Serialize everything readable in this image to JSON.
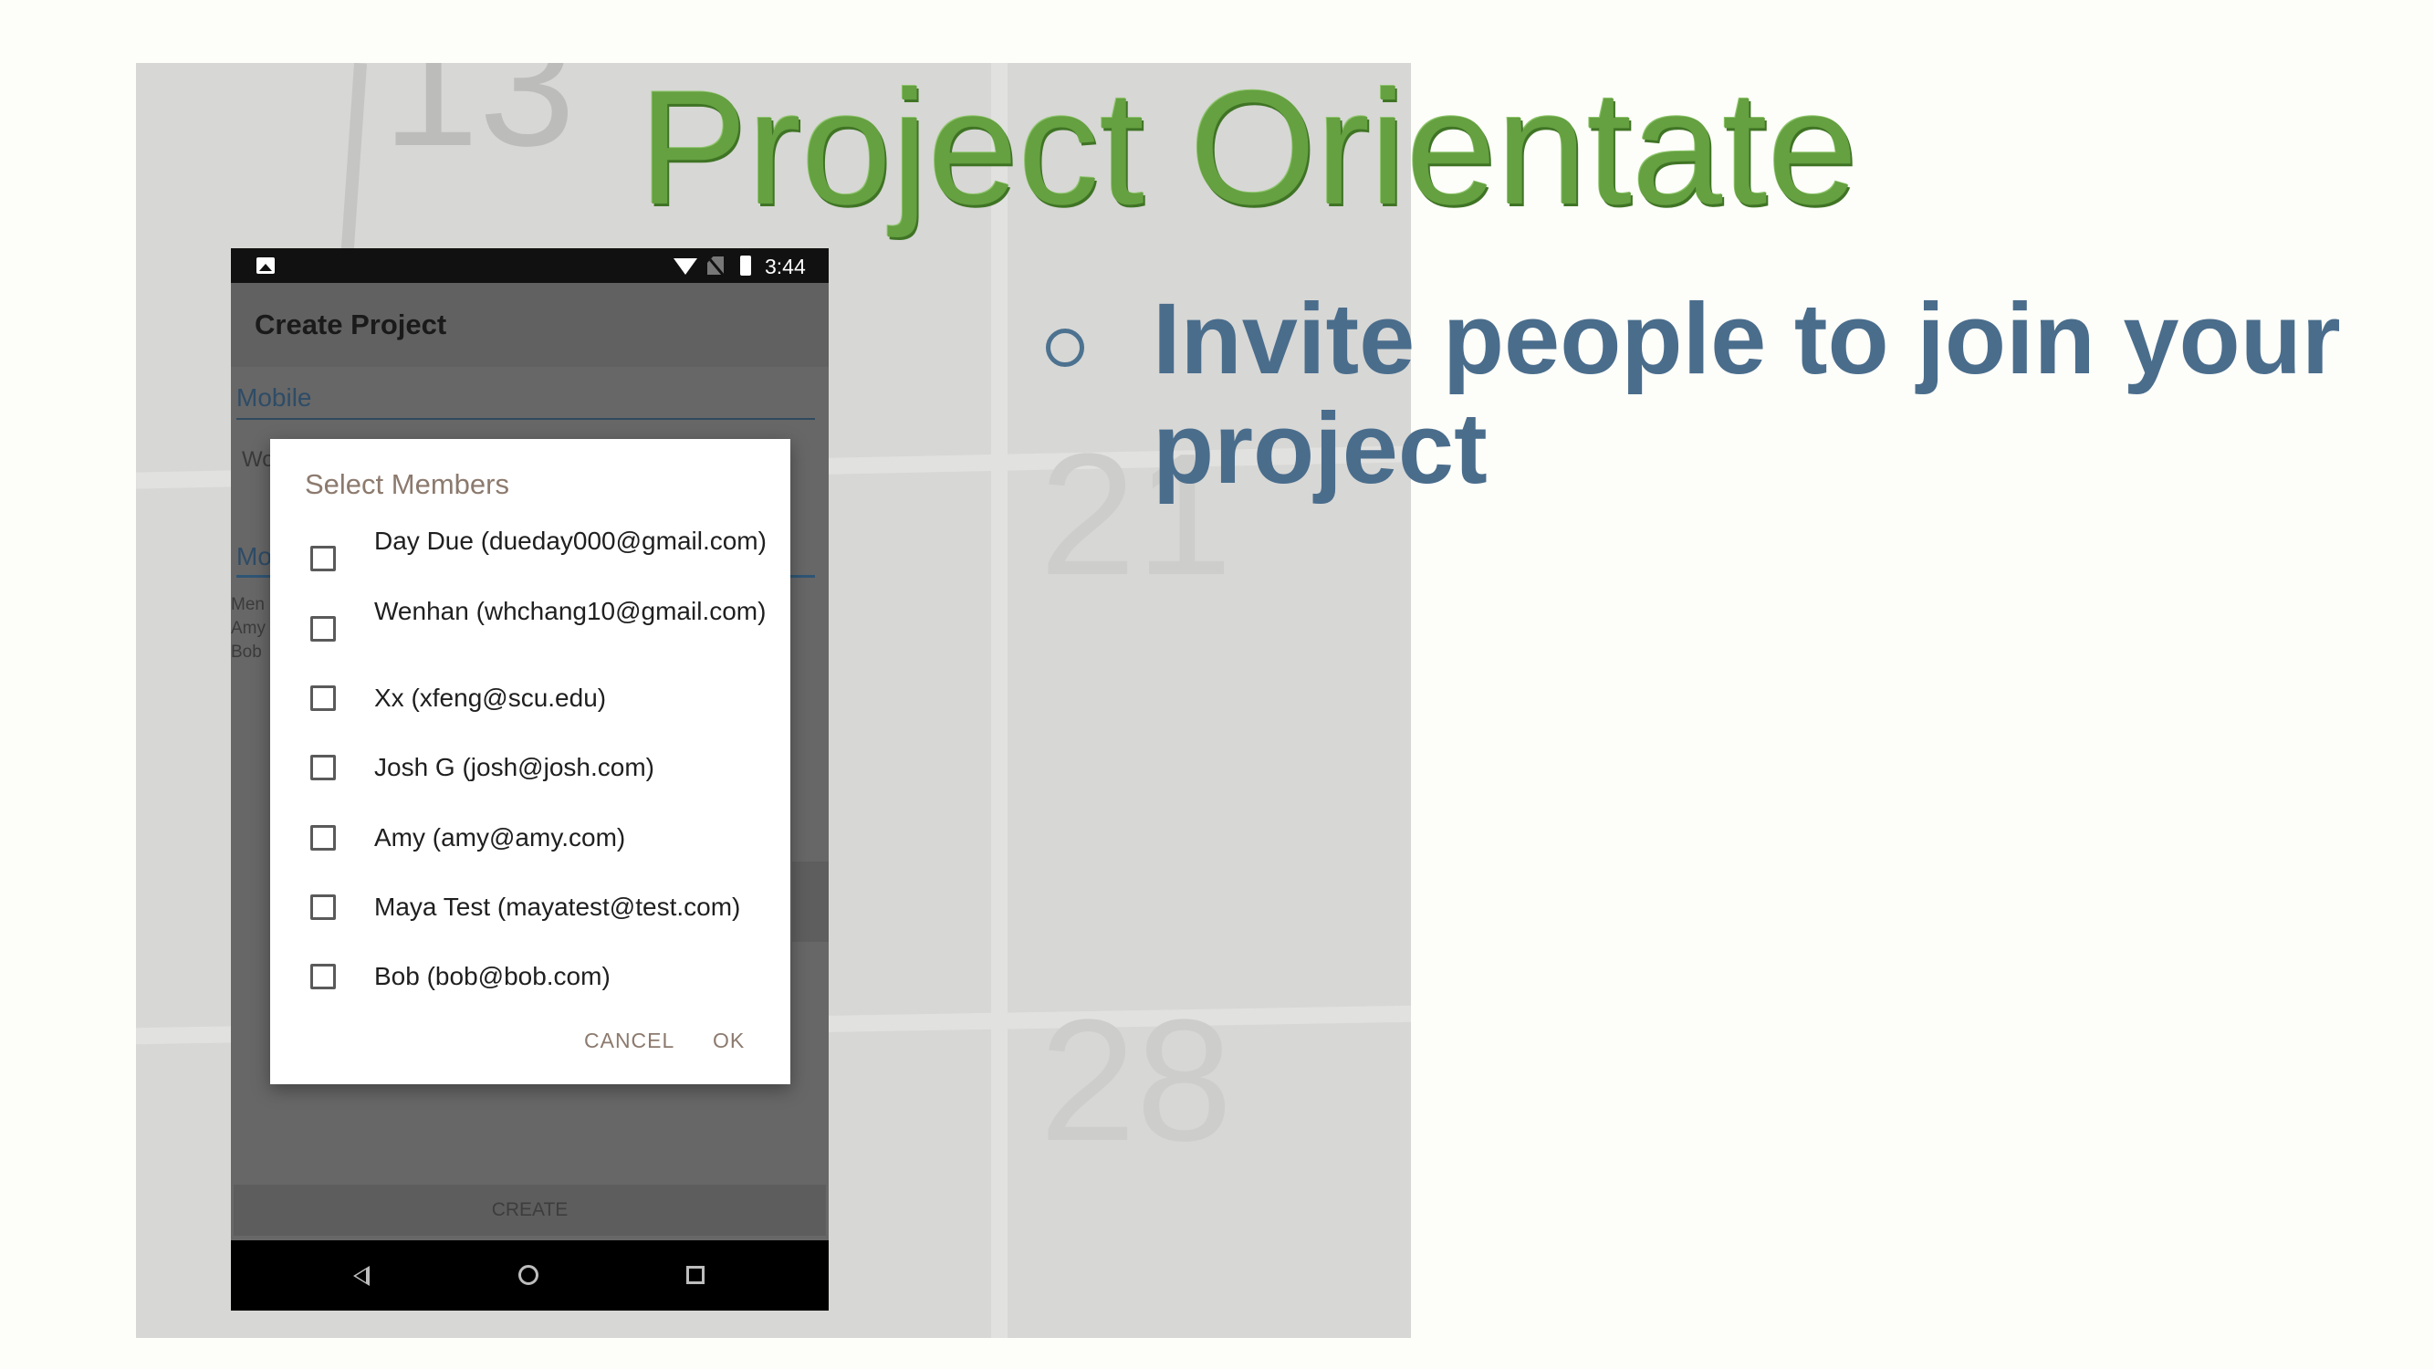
{
  "slide": {
    "title": "Project Orientate",
    "bullet": "Invite people to join your project"
  },
  "calendar_background": {
    "numbers": [
      "13",
      "21",
      "28"
    ]
  },
  "phone": {
    "status_bar": {
      "time": "3:44"
    },
    "app_bar": {
      "title": "Create Project"
    },
    "fields": {
      "project_type": "Mobile",
      "second_field_partial": "Wo",
      "third_field_partial": "Mo"
    },
    "members_preview": [
      "Men",
      "Amy",
      "Bob"
    ],
    "create_button": "CREATE"
  },
  "dialog": {
    "title": "Select Members",
    "members": [
      {
        "label": "Day Due (dueday000@gmail.com)",
        "checked": false
      },
      {
        "label": "Wenhan (whchang10@gmail.com)",
        "checked": false
      },
      {
        "label": "Xx (xfeng@scu.edu)",
        "checked": false
      },
      {
        "label": "Josh G (josh@josh.com)",
        "checked": false
      },
      {
        "label": "Amy (amy@amy.com)",
        "checked": false
      },
      {
        "label": "Maya Test (mayatest@test.com)",
        "checked": false
      },
      {
        "label": "Bob (bob@bob.com)",
        "checked": false
      }
    ],
    "cancel_label": "CANCEL",
    "ok_label": "OK"
  },
  "colors": {
    "title_green": "#65a041",
    "bullet_blue": "#4a6d8c",
    "dialog_accent": "#8c7a6e",
    "calendar_gray": "#d7d7d5"
  }
}
